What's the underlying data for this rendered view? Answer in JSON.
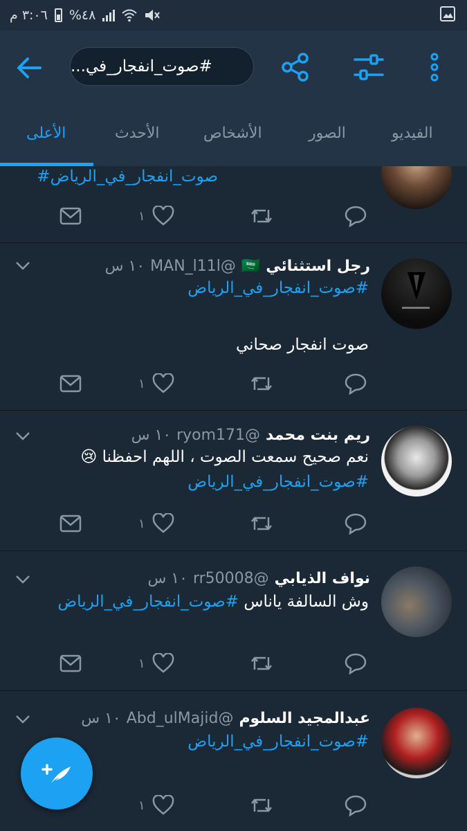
{
  "status_bar": {
    "time": "٣:٠٦ م",
    "battery": "%٤٨"
  },
  "header": {
    "search_text": "#صوت_انفجار_في...",
    "icons": [
      "back-arrow-icon",
      "share-icon",
      "filter-sliders-icon",
      "more-vertical-icon"
    ]
  },
  "tabs": [
    {
      "label": "الأعلى",
      "active": true
    },
    {
      "label": "الأحدث",
      "active": false
    },
    {
      "label": "الأشخاص",
      "active": false
    },
    {
      "label": "الصور",
      "active": false
    },
    {
      "label": "الفيديو",
      "active": false
    }
  ],
  "colors": {
    "accent": "#1da1f2",
    "background": "#1b2836",
    "bar": "#243447"
  },
  "tweets": [
    {
      "partial": true,
      "hashtag": "صوت_انفجار_في_الرياض#",
      "likes": "١"
    },
    {
      "name": "رجل استثنائي",
      "flag": "🇸🇦",
      "handle": "@MAN_l11l",
      "time": "١٠ س",
      "hashtag": "#صوت_انفجار_في_الرياض",
      "text": "صوت انفجار صحاني",
      "likes": "١"
    },
    {
      "name": "ريم بنت محمد",
      "handle": "@ryom171",
      "time": "١٠ س",
      "text": "نعم صحيح سمعت الصوت ، اللهم احفظنا",
      "emoji": "😢",
      "hashtag": "#صوت_انفجار_في_الرياض",
      "likes": "١"
    },
    {
      "name": "نواف الذيابي",
      "handle": "@rr50008",
      "time": "١٠ س",
      "text": "وش السالفة ياناس ",
      "hashtag": "#صوت_انفجار_في_الرياض",
      "likes": "١"
    },
    {
      "name": "عبدالمجيد السلوم",
      "handle": "@Abd_ulMajid",
      "time": "١٠ س",
      "hashtag": "#صوت_انفجار_في_الرياض",
      "likes": "١"
    }
  ]
}
